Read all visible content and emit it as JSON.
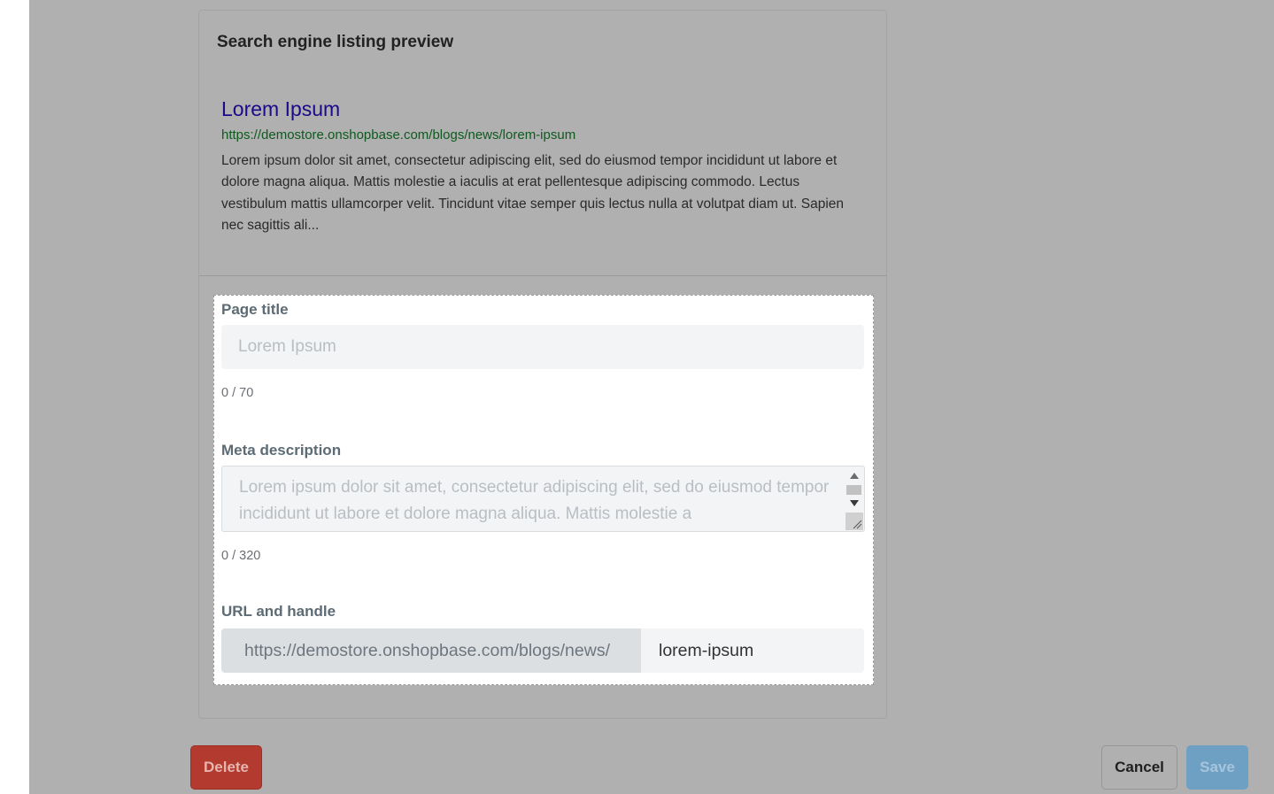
{
  "seo_card": {
    "title": "Search engine listing preview",
    "preview": {
      "title": "Lorem Ipsum",
      "url": "https://demostore.onshopbase.com/blogs/news/lorem-ipsum",
      "description": "Lorem ipsum dolor sit amet, consectetur adipiscing elit, sed do eiusmod tempor incididunt ut labore et dolore magna aliqua. Mattis molestie a iaculis at erat pellentesque adipiscing commodo. Lectus vestibulum mattis ullamcorper velit. Tincidunt vitae semper quis lectus nulla at volutpat diam ut. Sapien nec sagittis ali..."
    },
    "page_title": {
      "label": "Page title",
      "placeholder": "Lorem Ipsum",
      "counter": "0 / 70"
    },
    "meta_description": {
      "label": "Meta description",
      "placeholder": "Lorem ipsum dolor sit amet, consectetur adipiscing elit, sed do eiusmod tempor incididunt ut labore et dolore magna aliqua. Mattis molestie a",
      "counter": "0 / 320"
    },
    "url_handle": {
      "label": "URL and handle",
      "prefix": "https://demostore.onshopbase.com/blogs/news/",
      "handle": "lorem-ipsum"
    }
  },
  "actions": {
    "delete_label": "Delete",
    "cancel_label": "Cancel",
    "save_label": "Save"
  },
  "colors": {
    "overlay": "#b0b0b0",
    "delete": "#b23a2e",
    "save": "#6ea0c4",
    "preview_title": "#1a0a8a",
    "preview_url": "#0e5a1e"
  },
  "icons": [
    "scroll-up-arrow-icon",
    "scroll-down-arrow-icon",
    "resize-grip-icon"
  ]
}
